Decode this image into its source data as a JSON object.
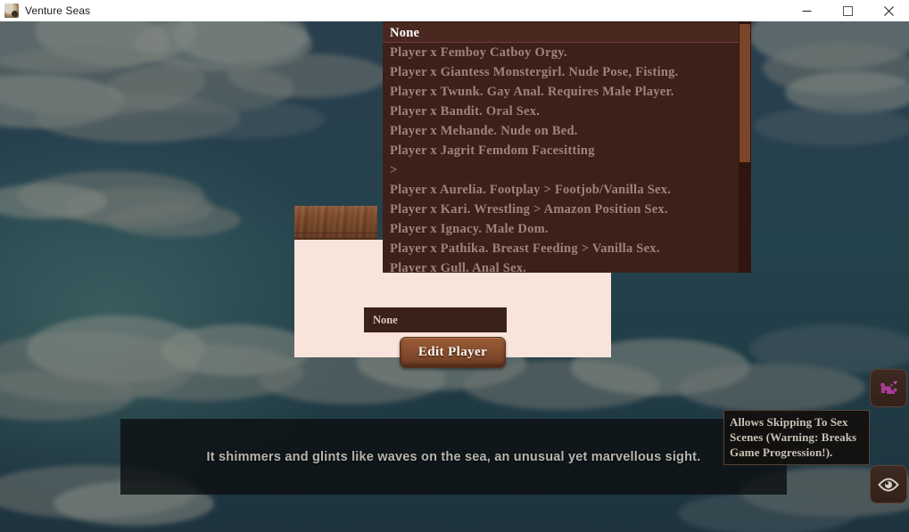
{
  "window": {
    "title": "Venture Seas",
    "icon": "character-portrait-icon",
    "controls": {
      "minimize": "minimize-icon",
      "maximize": "maximize-icon",
      "close": "close-icon"
    }
  },
  "dropdown": {
    "items": [
      "None",
      "Player x Femboy Catboy Orgy.",
      "Player x Giantess Monstergirl. Nude Pose, Fisting.",
      "Player x Twunk. Gay Anal. Requires Male Player.",
      "Player x Bandit. Oral Sex.",
      "Player x Mehande. Nude on Bed.",
      "Player x Jagrit Femdom Facesitting",
      ">",
      "Player x Aurelia. Footplay > Footjob/Vanilla Sex.",
      "Player x Kari. Wrestling > Amazon Position Sex.",
      "Player x Ignacy. Male Dom.",
      "Player x Pathika. Breast Feeding > Vanilla Sex.",
      "Player x Gull. Anal Sex."
    ],
    "selected_index": 0
  },
  "panel": {
    "selected_value": "None",
    "edit_player_label": "Edit Player"
  },
  "dialogue": {
    "text": "It shimmers and glints like waves on the sea, an unusual yet marvellous sight."
  },
  "side_buttons": {
    "skip_sex_scene": {
      "icon": "sex-scene-skip-icon",
      "tooltip": "Allows Skipping To Sex Scenes (Warning: Breaks Game Progression!)."
    },
    "toggle_ui": {
      "icon": "eye-icon"
    }
  },
  "colors": {
    "sky": "#24424c",
    "panel_background": "#f8e4da",
    "dropdown_background": "#3d2019",
    "dropdown_text": "#9d8679",
    "dropdown_selected_text": "#ffffff",
    "button_wood": "#8a5030",
    "scrollbar_thumb": "#7b4628",
    "accent_pink": "#b4439c",
    "tooltip_background": "#12100e"
  }
}
